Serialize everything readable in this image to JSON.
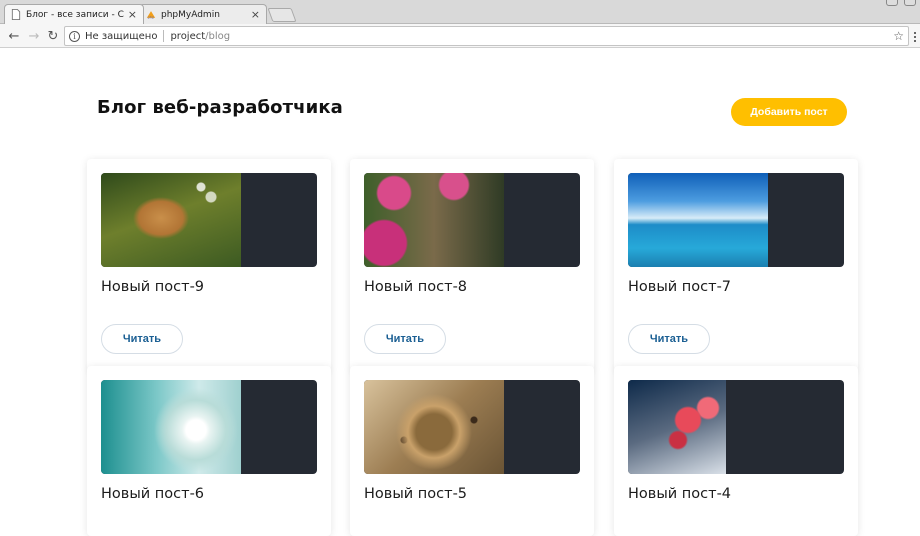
{
  "browser": {
    "tabs": [
      {
        "title": "Блог - все записи - Сайт п",
        "active": true
      },
      {
        "title": "phpMyAdmin",
        "active": false
      }
    ],
    "address": {
      "security_text": "Не защищено",
      "host": "project",
      "path": "/blog"
    }
  },
  "page": {
    "title": "Блог веб-разработчика",
    "add_post_label": "Добавить пост",
    "accent_color": "#ffbf00"
  },
  "posts": [
    {
      "title": "Новый пост-9",
      "read_label": "Читать",
      "image": "golden-retriever-bubbles"
    },
    {
      "title": "Новый пост-8",
      "read_label": "Читать",
      "image": "flower-garden-path"
    },
    {
      "title": "Новый пост-7",
      "read_label": "Читать",
      "image": "sea-and-clouds"
    },
    {
      "title": "Новый пост-6",
      "image": "dandelion"
    },
    {
      "title": "Новый пост-5",
      "image": "leopard"
    },
    {
      "title": "Новый пост-4",
      "image": "red-flowers"
    }
  ]
}
